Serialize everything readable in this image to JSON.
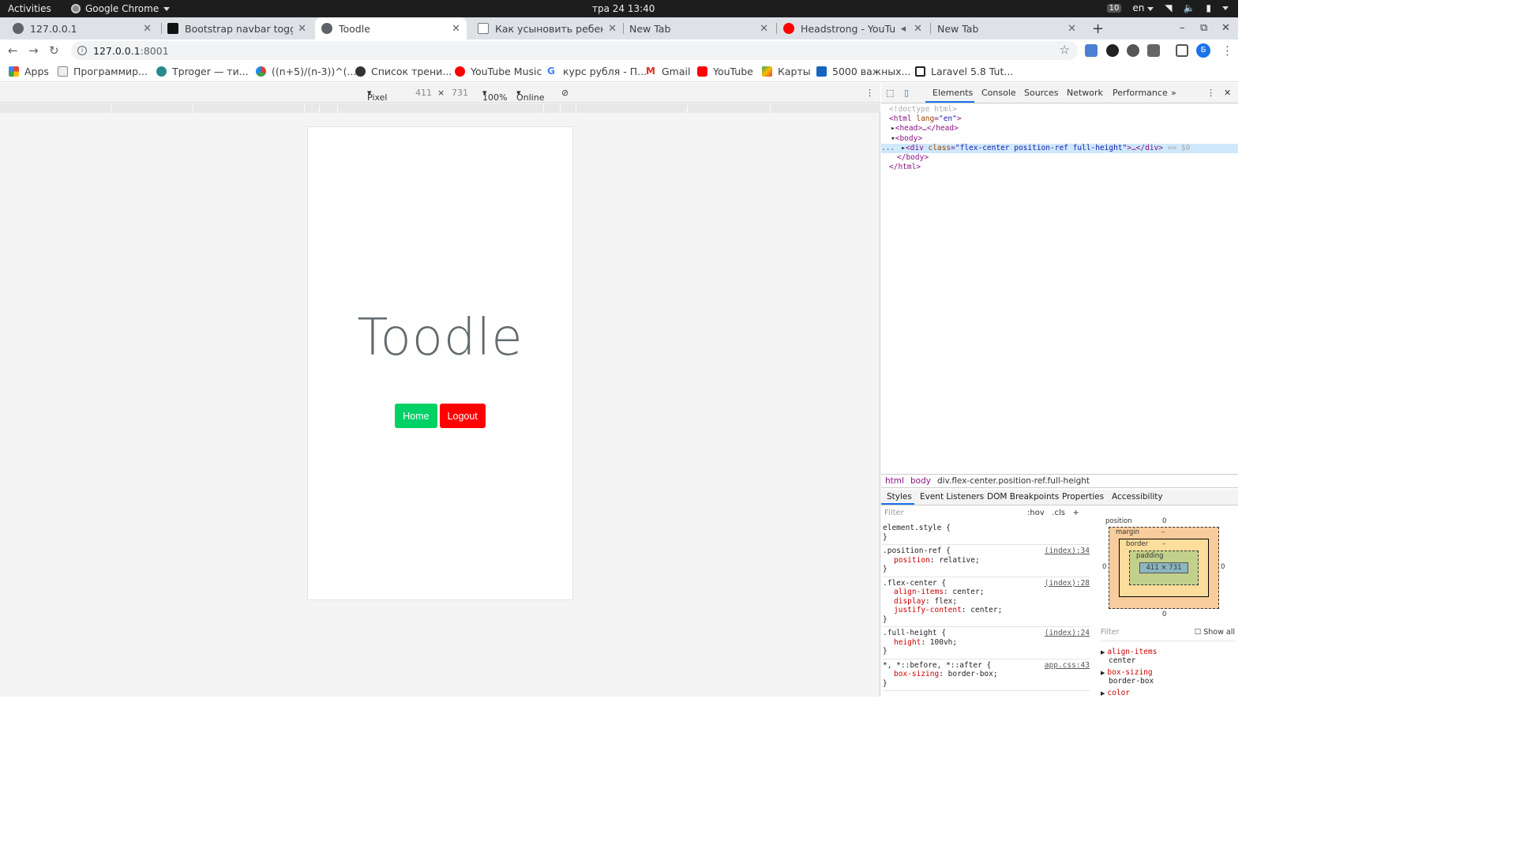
{
  "topbar": {
    "activities": "Activities",
    "app_name": "Google Chrome",
    "clock": "тра 24  13:40",
    "badge": "10",
    "lang": "en"
  },
  "tabs": [
    {
      "title": "127.0.0.1"
    },
    {
      "title": "Bootstrap navbar toggle"
    },
    {
      "title": "Toodle"
    },
    {
      "title": "Как усыновить ребенка"
    },
    {
      "title": "New Tab"
    },
    {
      "title": "Headstrong - YouTube"
    },
    {
      "title": "New Tab"
    }
  ],
  "address": {
    "host": "127.0.0.1",
    "port": ":8001"
  },
  "bookmarks": [
    {
      "label": "Apps"
    },
    {
      "label": "Программир..."
    },
    {
      "label": "Tproger — ти..."
    },
    {
      "label": "((n+5)/(n-3))^(..."
    },
    {
      "label": "Список трени..."
    },
    {
      "label": "YouTube Music"
    },
    {
      "label": "курс рубля - П..."
    },
    {
      "label": "Gmail"
    },
    {
      "label": "YouTube"
    },
    {
      "label": "Карты"
    },
    {
      "label": "5000 важных..."
    },
    {
      "label": "Laravel 5.8 Tut..."
    }
  ],
  "device_toolbar": {
    "device": "Pixel 2",
    "width": "411",
    "x": "×",
    "height": "731",
    "zoom": "100%",
    "network": "Online"
  },
  "page": {
    "brand": "Toodle",
    "home_label": "Home",
    "logout_label": "Logout",
    "home_color": "#00d166",
    "logout_color": "#fe0000"
  },
  "devtools": {
    "tabs": [
      "Elements",
      "Console",
      "Sources",
      "Network",
      "Performance"
    ],
    "more": "»",
    "dom": {
      "doctype": "<!doctype html>",
      "html_open_tag": "html",
      "html_attr": "lang",
      "html_attr_val": "\"en\"",
      "head": "<head>…</head>",
      "body_open": "<body>",
      "div_tag": "div",
      "div_attr": "class",
      "div_attr_val": "\"flex-center position-ref full-height\"",
      "div_close": ">…</div>",
      "div_eq": "== $0",
      "body_close": "</body>",
      "html_close": "</html>",
      "ellipsis": "..."
    },
    "breadcrumbs": [
      "html",
      "body",
      "div.flex-center.position-ref.full-height"
    ],
    "style_tabs": [
      "Styles",
      "Event Listeners",
      "DOM Breakpoints",
      "Properties",
      "Accessibility"
    ],
    "filter_placeholder": "Filter",
    "hov": ":hov",
    "cls": ".cls",
    "add": "+",
    "rules": [
      {
        "selector": "element.style {",
        "source": "",
        "props": []
      },
      {
        "selector": ".position-ref {",
        "source": "(index):34",
        "props": [
          [
            "position",
            "relative;"
          ]
        ]
      },
      {
        "selector": ".flex-center {",
        "source": "(index):28",
        "props": [
          [
            "align-items",
            "center;"
          ],
          [
            "display",
            "flex;"
          ],
          [
            "justify-content",
            "center;"
          ]
        ]
      },
      {
        "selector": ".full-height {",
        "source": "(index):24",
        "props": [
          [
            "height",
            "100vh;"
          ]
        ]
      },
      {
        "selector": "*, *::before, *::after {",
        "source": "app.css:43",
        "props": [
          [
            "box-sizing",
            "border-box;"
          ]
        ]
      }
    ],
    "boxmodel": {
      "position": "position",
      "position_val": "0",
      "margin": "margin",
      "border": "border",
      "padding": "padding",
      "dash": "–",
      "content": "411 × 731",
      "left_zero": "0",
      "right_zero": "0",
      "bottom_zero": "0"
    },
    "computed_filter": "Filter",
    "show_all": "Show all",
    "computed": [
      {
        "prop": "align-items",
        "val": "center"
      },
      {
        "prop": "box-sizing",
        "val": "border-box"
      },
      {
        "prop": "color",
        "val": ""
      }
    ]
  }
}
